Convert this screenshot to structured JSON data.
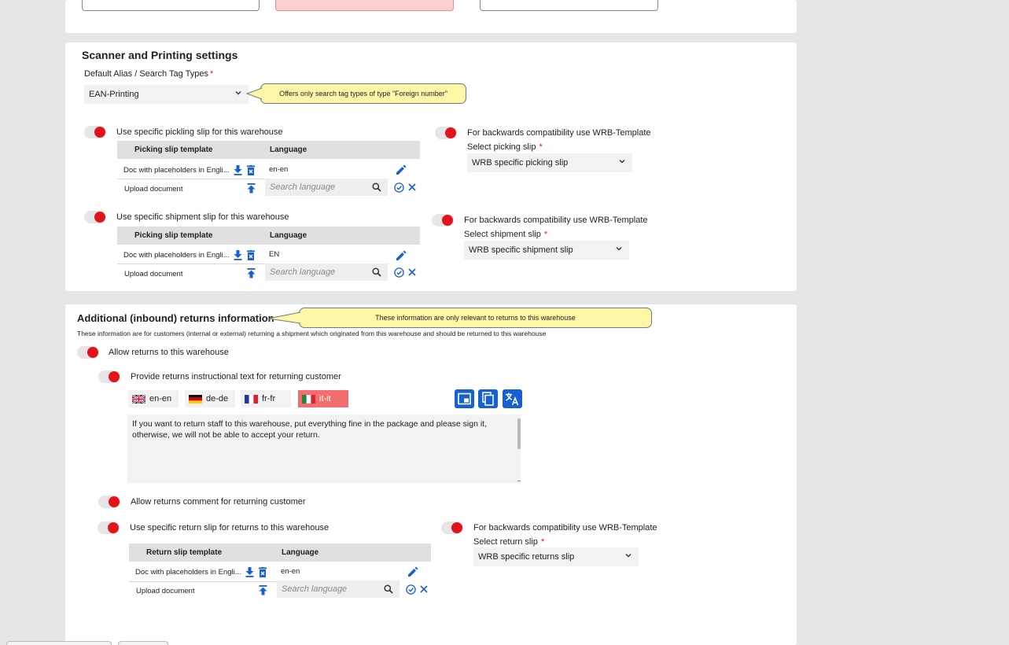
{
  "scanner": {
    "title": "Scanner and Printing settings",
    "alias_label": "Default Alias / Search Tag Types",
    "required_mark": "*",
    "alias_value": "EAN-Printing",
    "alias_tooltip": "Offers only search tag types of type \"Foreign number\"",
    "picking": {
      "toggle_label": "Use specific pickling slip for this warehouse",
      "col_template": "Picking slip template",
      "col_language": "Language",
      "doc_name": "Doc with placeholders in Engli...",
      "doc_language": "en-en",
      "upload_label": "Upload document",
      "search_placeholder": "Search language",
      "compat_label": "For backwards compatibility use WRB-Template",
      "select_label": "Select picking slip",
      "select_value": "WRB specific picking slip"
    },
    "shipment": {
      "toggle_label": "Use specific shipment slip for this warehouse",
      "col_template": "Picking slip template",
      "col_language": "Language",
      "doc_name": "Doc with placeholders in Engli...",
      "doc_language": "EN",
      "upload_label": "Upload document",
      "search_placeholder": "Search language",
      "compat_label": "For backwards compatibility use WRB-Template",
      "select_label": "Select shipment slip",
      "select_value": "WRB specific shipment slip"
    }
  },
  "returns": {
    "title": "Additional (inbound) returns information",
    "title_tooltip": "These information are only relevant to returns to this warehouse",
    "description": "These information are for customers (internal or external) returning a shipment which originated from this warehouse and should be returned to this warehouse",
    "allow_label": "Allow returns to this warehouse",
    "instructional_label": "Provide returns instructional text for returning customer",
    "languages": [
      {
        "code": "en-en",
        "flag": "uk-flag-icon"
      },
      {
        "code": "de-de",
        "flag": "germany-flag-icon"
      },
      {
        "code": "fr-fr",
        "flag": "france-flag-icon"
      },
      {
        "code": "it-it",
        "flag": "italy-flag-icon"
      }
    ],
    "active_language": "it-it",
    "instruction_text": "If you want to return staff to this warehouse, put everything fine in the package and please sign it, otherwise, we will not be able to accept your return.",
    "comment_label": "Allow returns comment for returning customer",
    "return_slip": {
      "toggle_label": "Use specific return slip for returns to this warehouse",
      "col_template": "Return slip template",
      "col_language": "Language",
      "doc_name": "Doc with placeholders in Engli...",
      "doc_language": "en-en",
      "upload_label": "Upload document",
      "search_placeholder": "Search language",
      "compat_label": "For backwards compatibility use WRB-Template",
      "select_label": "Select return slip",
      "select_value": "WRB specific returns slip"
    }
  },
  "colors": {
    "accent": "#1760d1",
    "toggle_on": "#e3131b",
    "tooltip_bg": "#fdf7a8",
    "active_tab": "#f26d6d"
  }
}
